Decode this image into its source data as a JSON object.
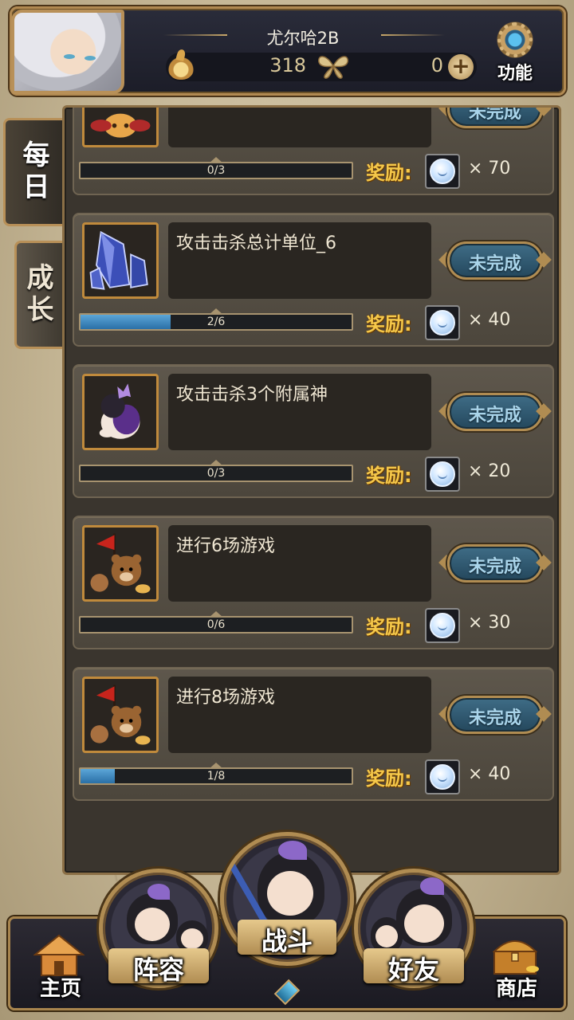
{
  "header": {
    "player_name": "尤尔哈2B",
    "currency_a_icon": "flame-icon",
    "currency_a_amount": "318",
    "currency_b_icon": "butterfly-icon",
    "currency_b_amount": "0",
    "plus_label": "+",
    "function_label": "功能"
  },
  "side_tabs": {
    "daily": [
      "每",
      "日"
    ],
    "growth": [
      "成",
      "长"
    ]
  },
  "tasks": [
    {
      "title": "",
      "status": "未完成",
      "progress": "0/3",
      "progress_fraction": 0,
      "reward_label": "奖励:",
      "reward_count": "× 70",
      "icon": "wing-creature-icon"
    },
    {
      "title": "攻击击杀总计单位_6",
      "status": "未完成",
      "progress": "2/6",
      "progress_fraction": 0.333,
      "reward_label": "奖励:",
      "reward_count": "× 40",
      "icon": "crystal-icon"
    },
    {
      "title": "攻击击杀3个附属神",
      "status": "未完成",
      "progress": "0/3",
      "progress_fraction": 0,
      "reward_label": "奖励:",
      "reward_count": "× 20",
      "icon": "chibi-girl-icon"
    },
    {
      "title": "进行6场游戏",
      "status": "未完成",
      "progress": "0/6",
      "progress_fraction": 0,
      "reward_label": "奖励:",
      "reward_count": "× 30",
      "icon": "bear-flag-icon"
    },
    {
      "title": "进行8场游戏",
      "status": "未完成",
      "progress": "1/8",
      "progress_fraction": 0.125,
      "reward_label": "奖励:",
      "reward_count": "× 40",
      "icon": "bear-flag-icon"
    }
  ],
  "bottom_nav": {
    "home": "主页",
    "lineup": "阵容",
    "battle": "战斗",
    "friends": "好友",
    "shop": "商店"
  },
  "colors": {
    "reward_text": "#f5c84a",
    "progress_fill": "#3d8cc6",
    "frame_gold": "#b08c52"
  }
}
